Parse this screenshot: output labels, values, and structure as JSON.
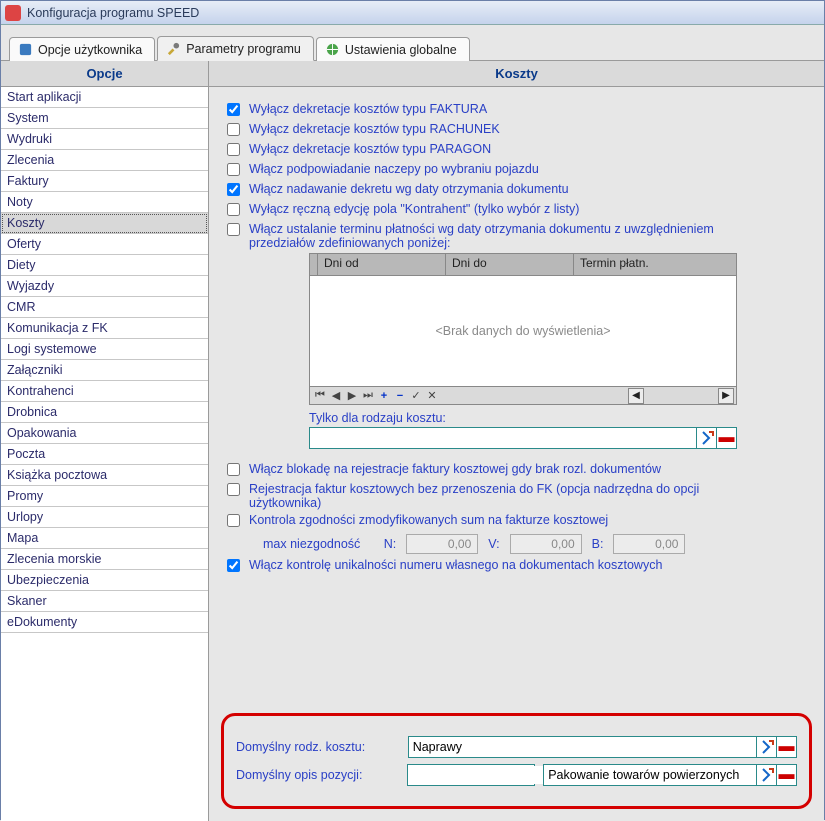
{
  "window": {
    "title": "Konfiguracja programu SPEED"
  },
  "tabs": {
    "user_options": "Opcje użytkownika",
    "program_params": "Parametry programu",
    "global_settings": "Ustawienia globalne"
  },
  "left": {
    "header": "Opcje",
    "items": [
      "Start aplikacji",
      "System",
      "Wydruki",
      "Zlecenia",
      "Faktury",
      "Noty",
      "Koszty",
      "Oferty",
      "Diety",
      "Wyjazdy",
      "CMR",
      "Komunikacja z FK",
      "Logi systemowe",
      "Załączniki",
      "Kontrahenci",
      "Drobnica",
      "Opakowania",
      "Poczta",
      "Książka pocztowa",
      "Promy",
      "Urlopy",
      "Mapa",
      "Zlecenia morskie",
      "Ubezpieczenia",
      "Skaner",
      "eDokumenty"
    ],
    "selected_index": 6
  },
  "right": {
    "header": "Koszty",
    "checks": {
      "c1": "Wyłącz dekretacje kosztów typu FAKTURA",
      "c2": "Wyłącz dekretacje kosztów typu RACHUNEK",
      "c3": "Wyłącz dekretacje kosztów typu PARAGON",
      "c4": "Włącz podpowiadanie naczepy po wybraniu pojazdu",
      "c5": "Włącz nadawanie dekretu wg daty otrzymania dokumentu",
      "c6": "Wyłącz ręczną edycję pola \"Kontrahent\" (tylko wybór z listy)",
      "c7": "Włącz ustalanie terminu płatności wg daty otrzymania dokumentu z uwzględnieniem przedziałów zdefiniowanych poniżej:"
    },
    "grid": {
      "col1": "Dni od",
      "col2": "Dni do",
      "col3": "Termin płatn.",
      "empty": "<Brak danych do wyświetlenia>"
    },
    "only_for_kind": "Tylko dla rodzaju kosztu:",
    "checks2": {
      "c8": "Włącz blokadę na rejestracje faktury kosztowej gdy brak rozl. dokumentów",
      "c9": "Rejestracja faktur kosztowych bez przenoszenia do FK (opcja nadrzędna do opcji użytkownika)",
      "c10": "Kontrola zgodności zmodyfikowanych sum na fakturze kosztowej"
    },
    "maxrow": {
      "label": "max niezgodność",
      "n_label": "N:",
      "v_label": "V:",
      "b_label": "B:",
      "n_val": "0,00",
      "v_val": "0,00",
      "b_val": "0,00"
    },
    "c11": "Włącz kontrolę unikalności numeru własnego na dokumentach kosztowych",
    "default_kind_label": "Domyślny rodz. kosztu:",
    "default_kind_value": "Naprawy",
    "default_desc_label": "Domyślny opis pozycji:",
    "default_desc_value": "",
    "default_desc2_value": "Pakowanie towarów powierzonych"
  }
}
